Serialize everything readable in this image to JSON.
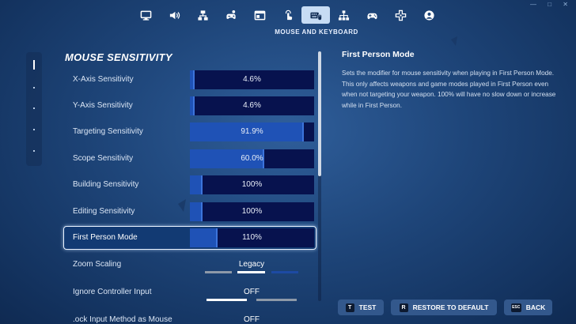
{
  "header": {
    "tabs": [
      {
        "icon": "monitor-icon",
        "active": false
      },
      {
        "icon": "speaker-icon",
        "active": false
      },
      {
        "icon": "sitemap-icon",
        "active": false
      },
      {
        "icon": "controller-person-icon",
        "active": false
      },
      {
        "icon": "window-icon",
        "active": false
      },
      {
        "icon": "touch-icon",
        "active": false
      },
      {
        "icon": "mouse-keyboard-icon",
        "active": true
      },
      {
        "icon": "network-icon",
        "active": false
      },
      {
        "icon": "gamepad-icon",
        "active": false
      },
      {
        "icon": "dpad-icon",
        "active": false
      },
      {
        "icon": "account-icon",
        "active": false
      }
    ],
    "active_caption": "MOUSE AND KEYBOARD"
  },
  "section": {
    "title": "MOUSE SENSITIVITY"
  },
  "sliders": [
    {
      "label": "X-Axis Sensitivity",
      "value": "4.6%",
      "fill": 0.04
    },
    {
      "label": "Y-Axis Sensitivity",
      "value": "4.6%",
      "fill": 0.04
    },
    {
      "label": "Targeting Sensitivity",
      "value": "91.9%",
      "fill": 0.92
    },
    {
      "label": "Scope Sensitivity",
      "value": "60.0%",
      "fill": 0.6
    },
    {
      "label": "Building Sensitivity",
      "value": "100%",
      "fill": 0.1
    },
    {
      "label": "Editing Sensitivity",
      "value": "100%",
      "fill": 0.1
    },
    {
      "label": "First Person Mode",
      "value": "110%",
      "fill": 0.22,
      "selected": true
    }
  ],
  "options": [
    {
      "label": "Zoom Scaling",
      "value": "Legacy",
      "segments": 3,
      "selected_segment": 1
    },
    {
      "label": "Ignore Controller Input",
      "value": "OFF",
      "segments": 2,
      "selected_segment": 0
    },
    {
      "label": ".ock Input Method as Mouse",
      "value": "OFF"
    }
  ],
  "description": {
    "title": "First Person Mode",
    "body": "Sets the modifier for mouse sensitivity when playing in First Person Mode. This only affects weapons and game modes played in First Person even when not targeting your weapon. 100% will have no slow down or increase while in First Person."
  },
  "footer": {
    "test": {
      "key": "T",
      "label": "TEST"
    },
    "restore": {
      "key": "R",
      "label": "RESTORE TO DEFAULT"
    },
    "back": {
      "key": "ESC",
      "label": "BACK"
    }
  },
  "colors": {
    "accent": "#1f52b6",
    "bar_bg": "#07124e",
    "active_tab": "#c7dcf4",
    "button": "#33588c"
  }
}
